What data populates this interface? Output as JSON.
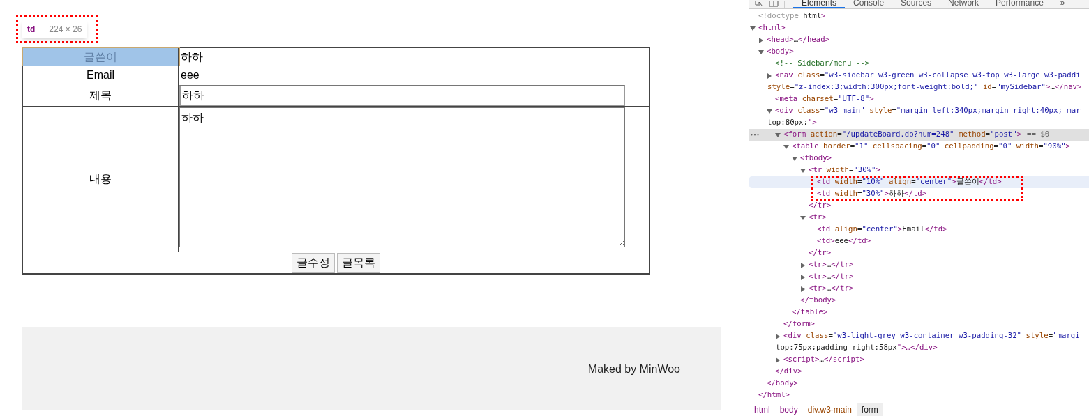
{
  "page": {
    "inspector_tooltip": {
      "tag": "td",
      "size": "224 × 26"
    },
    "form_rows": [
      {
        "label": "글쓴이",
        "kind": "text",
        "value": "하하",
        "highlighted": true
      },
      {
        "label": "Email",
        "kind": "text",
        "value": "eee",
        "highlighted": false
      },
      {
        "label": "제목",
        "kind": "input",
        "value": "하하",
        "highlighted": false
      },
      {
        "label": "내용",
        "kind": "textarea",
        "value": "하하",
        "highlighted": false
      }
    ],
    "buttons": [
      "글수정",
      "글목록"
    ],
    "footer": "Maked by MinWoo"
  },
  "devtools": {
    "tabs": [
      {
        "label": "Elements",
        "selected": true
      },
      {
        "label": "Console",
        "selected": false
      },
      {
        "label": "Sources",
        "selected": false
      },
      {
        "label": "Network",
        "selected": false
      },
      {
        "label": "Performance",
        "selected": false
      },
      {
        "label": "»",
        "selected": false
      }
    ],
    "tree": [
      {
        "lines": [
          "<!doctype html>"
        ],
        "selected": false,
        "hovered": false
      },
      {
        "lines": [
          "<html>"
        ],
        "selected": false,
        "hovered": false,
        "expanded": true,
        "close": "</html>",
        "children": [
          {
            "lines": [
              "<head>…</head>"
            ],
            "selected": false,
            "hovered": false,
            "expanded": false
          },
          {
            "lines": [
              "<body>"
            ],
            "selected": false,
            "hovered": false,
            "expanded": true,
            "close": "</body>",
            "children": [
              {
                "lines": [
                  "<!-- Sidebar/menu -->"
                ],
                "selected": false,
                "hovered": false
              },
              {
                "lines": [
                  "<nav class=\"w3-sidebar w3-green w3-collapse w3-top w3-large w3-paddi",
                  "style=\"z-index:3;width:300px;font-weight:bold;\" id=\"mySidebar\">…</nav>"
                ],
                "selected": false,
                "hovered": false,
                "expanded": false
              },
              {
                "lines": [
                  "<meta charset=\"UTF-8\">"
                ],
                "selected": false,
                "hovered": false
              },
              {
                "lines": [
                  "<div class=\"w3-main\" style=\"margin-left:340px;margin-right:40px; mar",
                  "top:80px;\">"
                ],
                "selected": false,
                "hovered": false,
                "expanded": true,
                "close": "</div>",
                "children": [
                  {
                    "lines": [
                      "<form action=\"/updateBoard.do?num=248\" method=\"post\">"
                    ],
                    "suffix": "== $0",
                    "selected": true,
                    "hovered": false,
                    "expanded": true,
                    "close": "</form>",
                    "children": [
                      {
                        "lines": [
                          "<table border=\"1\" cellspacing=\"0\" cellpadding=\"0\" width=\"90%\">"
                        ],
                        "selected": false,
                        "hovered": false,
                        "expanded": true,
                        "close": "</table>",
                        "children": [
                          {
                            "lines": [
                              "<tbody>"
                            ],
                            "selected": false,
                            "hovered": false,
                            "expanded": true,
                            "close": "</tbody>",
                            "children": [
                              {
                                "lines": [
                                  "<tr width=\"30%\">"
                                ],
                                "selected": false,
                                "hovered": false,
                                "expanded": true,
                                "close": "</tr>",
                                "children": [
                                  {
                                    "lines": [
                                      "<td width=\"10%\" align=\"center\">글쓴이</td>"
                                    ],
                                    "selected": false,
                                    "hovered": true
                                  },
                                  {
                                    "lines": [
                                      "<td width=\"30%\">하하</td>"
                                    ],
                                    "selected": false,
                                    "hovered": false
                                  }
                                ]
                              },
                              {
                                "lines": [
                                  "<tr>"
                                ],
                                "selected": false,
                                "hovered": false,
                                "expanded": true,
                                "close": "</tr>",
                                "children": [
                                  {
                                    "lines": [
                                      "<td align=\"center\">Email</td>"
                                    ],
                                    "selected": false,
                                    "hovered": false
                                  },
                                  {
                                    "lines": [
                                      "<td>eee</td>"
                                    ],
                                    "selected": false,
                                    "hovered": false
                                  }
                                ]
                              },
                              {
                                "lines": [
                                  "<tr>…</tr>"
                                ],
                                "selected": false,
                                "hovered": false,
                                "expanded": false
                              },
                              {
                                "lines": [
                                  "<tr>…</tr>"
                                ],
                                "selected": false,
                                "hovered": false,
                                "expanded": false
                              },
                              {
                                "lines": [
                                  "<tr>…</tr>"
                                ],
                                "selected": false,
                                "hovered": false,
                                "expanded": false
                              }
                            ]
                          }
                        ]
                      }
                    ]
                  },
                  {
                    "lines": [
                      "<div class=\"w3-light-grey w3-container w3-padding-32\" style=\"margi",
                      "top:75px;padding-right:58px\">…</div>"
                    ],
                    "selected": false,
                    "hovered": false,
                    "expanded": false
                  },
                  {
                    "lines": [
                      "<script>…</script>"
                    ],
                    "selected": false,
                    "hovered": false,
                    "expanded": false
                  }
                ]
              }
            ]
          }
        ]
      }
    ],
    "breadcrumbs": [
      {
        "label": "html",
        "selected": false
      },
      {
        "label": "body",
        "selected": false
      },
      {
        "label": "div.w3-main",
        "selected": false
      },
      {
        "label": "form",
        "selected": true
      }
    ]
  }
}
